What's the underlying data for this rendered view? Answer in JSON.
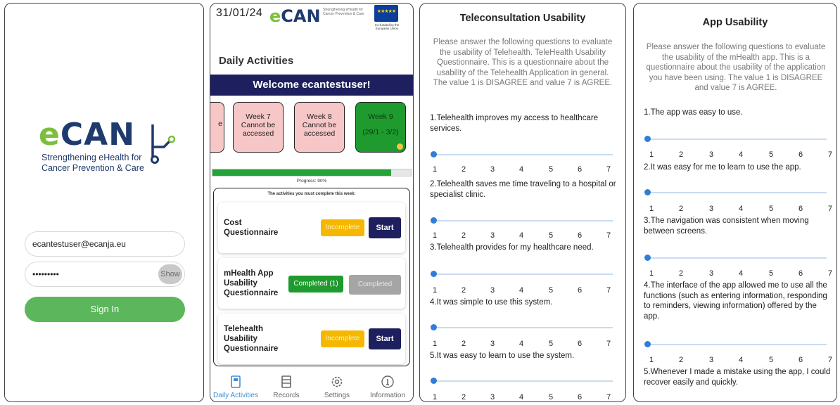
{
  "login": {
    "logo_word_e": "e",
    "logo_word_can": "CAN",
    "logo_sub_line1": "Strengthening eHealth for",
    "logo_sub_line2": "Cancer Prevention & Care",
    "email_value": "ecantestuser@ecanja.eu",
    "password_value": "•••••••••",
    "show_label": "Show",
    "signin_label": "Sign In",
    "accent_color": "#5cb75c"
  },
  "dashboard": {
    "date": "31/01/24",
    "logo_word_e": "e",
    "logo_word_can": "CAN",
    "logo_sub": "Strengthening eHealth for Cancer Prevention & Care",
    "eu_stars": "★★★★★",
    "eu_caption": "Co-funded by the European Union",
    "title": "Daily Activities",
    "welcome": "Welcome ecantestuser!",
    "weeks": [
      {
        "line1": "",
        "line2": "e",
        "state": "locked"
      },
      {
        "line1": "Week 7",
        "line2": "Cannot be accessed",
        "state": "locked"
      },
      {
        "line1": "Week 8",
        "line2": "Cannot be accessed",
        "state": "locked"
      },
      {
        "line1": "Week 9",
        "line2": "(29/1 - 3/2)",
        "state": "current"
      }
    ],
    "progress_label": "Progress: 90%",
    "progress_fraction": 0.9,
    "activities_heading": "The activities you must complete this week:",
    "activities": [
      {
        "name": "Cost Questionnaire",
        "status": "Incomplete",
        "action": "Start"
      },
      {
        "name": "mHealth App Usability Questionnaire",
        "status": "Completed (1)",
        "action": "Completed"
      },
      {
        "name": "Telehealth Usability Questionnaire",
        "status": "Incomplete",
        "action": "Start"
      }
    ],
    "nav": [
      {
        "label": "Daily Activities",
        "icon": "book-icon"
      },
      {
        "label": "Records",
        "icon": "records-icon"
      },
      {
        "label": "Settings",
        "icon": "gear-icon"
      },
      {
        "label": "Information",
        "icon": "info-icon"
      }
    ],
    "brand_navy": "#1d1f5e"
  },
  "teleconsultation": {
    "title": "Teleconsultation Usability",
    "intro": "Please answer the following questions to evaluate the usability of Telehealth. TeleHealth Usability Questionnaire. This is a questionnaire about the usability of the Telehealth Application in general. The value 1 is DISAGREE and value 7 is AGREE.",
    "questions": [
      "1.Telehealth improves my access to healthcare services.",
      "2.Telehealth saves me time traveling to a hospital or specialist clinic.",
      "3.Telehealth provides for my healthcare need.",
      "4.It was simple to use this system.",
      "5.It was easy to learn to use the system."
    ],
    "scale": [
      "1",
      "2",
      "3",
      "4",
      "5",
      "6",
      "7"
    ]
  },
  "app_usability": {
    "title": "App Usability",
    "intro": "Please answer the following questions to evaluate the usability of the mHealth app. This is a questionnaire about the usability of the application you have been using. The value 1 is DISAGREE and value 7 is AGREE.",
    "questions": [
      "1.The app was easy to use.",
      "2.It was easy for me to learn to use the app.",
      "3.The navigation was consistent when moving between screens.",
      "4.The interface of the app allowed me to use all the functions (such as entering information, responding to reminders, viewing information) offered by the app.",
      "5.Whenever I made a mistake using the app, I could recover easily and quickly."
    ],
    "scale": [
      "1",
      "2",
      "3",
      "4",
      "5",
      "6",
      "7"
    ]
  }
}
